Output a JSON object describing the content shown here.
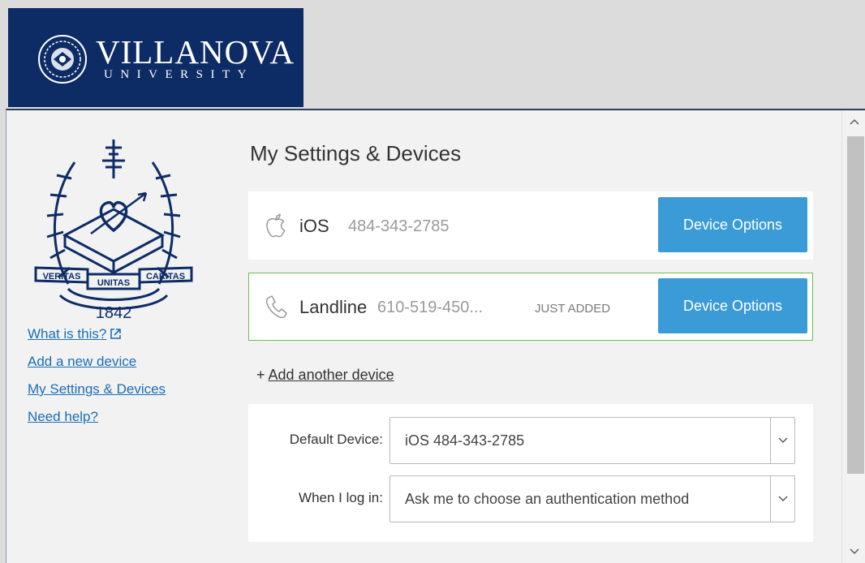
{
  "brand": {
    "name": "VILLANOVA",
    "subname": "UNIVERSITY"
  },
  "seal": {
    "motto_left": "VERITAS",
    "motto_center": "UNITAS",
    "motto_right": "CARITAS",
    "year": "1842"
  },
  "sidebar": {
    "items": [
      {
        "label": "What is this?"
      },
      {
        "label": "Add a new device"
      },
      {
        "label": "My Settings & Devices"
      },
      {
        "label": "Need help?"
      }
    ]
  },
  "main": {
    "title": "My Settings & Devices",
    "devices": [
      {
        "name": "iOS",
        "number": "484-343-2785",
        "badge": "",
        "button_label": "Device Options",
        "icon": "apple-icon"
      },
      {
        "name": "Landline",
        "number": "610-519-450...",
        "badge": "JUST ADDED",
        "button_label": "Device Options",
        "icon": "phone-icon"
      }
    ],
    "add_prefix": "+ ",
    "add_link": "Add another device",
    "preferences": [
      {
        "label": "Default Device:",
        "value": "iOS 484-343-2785"
      },
      {
        "label": "When I log in:",
        "value": "Ask me to choose an authentication method"
      }
    ]
  },
  "colors": {
    "brand_navy": "#0d2c66",
    "button_blue": "#3b9bd6",
    "link_blue": "#1a6eb4",
    "added_border": "#6cc04a"
  }
}
